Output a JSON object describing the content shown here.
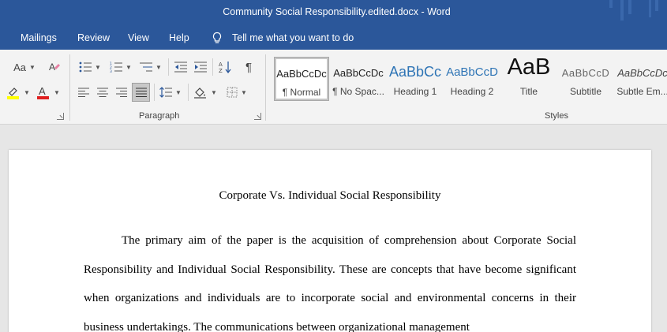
{
  "window": {
    "title": "Community Social Responsibility.edited.docx  -  Word"
  },
  "menu": {
    "tabs": [
      "Mailings",
      "Review",
      "View",
      "Help"
    ],
    "tell_me": "Tell me what you want to do"
  },
  "ribbon": {
    "font_group": {
      "change_case_label": "Aa"
    },
    "paragraph_group": {
      "label": "Paragraph",
      "pilcrow": "¶"
    },
    "styles_group": {
      "label": "Styles",
      "styles": [
        {
          "sample": "AaBbCcDc",
          "name": "¶ Normal",
          "selected": true
        },
        {
          "sample": "AaBbCcDc",
          "name": "¶ No Spac...",
          "selected": false
        },
        {
          "sample": "AaBbCc",
          "name": "Heading 1",
          "selected": false
        },
        {
          "sample": "AaBbCcD",
          "name": "Heading 2",
          "selected": false
        },
        {
          "sample": "AaB",
          "name": "Title",
          "selected": false
        },
        {
          "sample": "AaBbCcD",
          "name": "Subtitle",
          "selected": false
        },
        {
          "sample": "AaBbCcDc",
          "name": "Subtle Em...",
          "selected": false
        }
      ]
    },
    "colors": {
      "highlight": "#ffff00",
      "font_color": "#e02020"
    }
  },
  "document": {
    "heading": "Corporate Vs. Individual Social Responsibility",
    "paragraph": "The primary aim of the paper is the acquisition of comprehension about Corporate Social Responsibility and Individual Social Responsibility. These are concepts that have become significant when organizations and individuals are to incorporate social and environmental concerns in their business undertakings. The communications between organizational management"
  },
  "theme": {
    "accent": "#2b579a"
  }
}
